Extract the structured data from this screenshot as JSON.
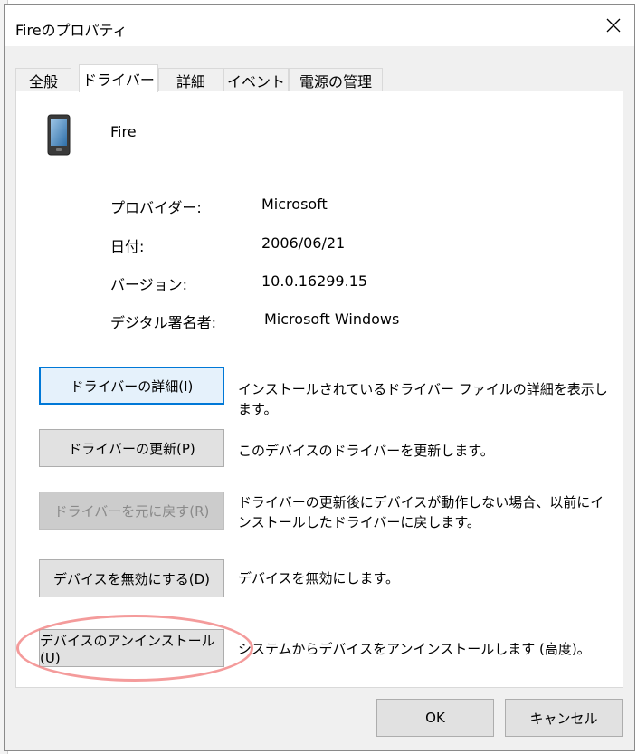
{
  "window": {
    "title": "Fireのプロパティ",
    "close_icon": "close-icon"
  },
  "tabs": [
    {
      "label": "全般",
      "active": false
    },
    {
      "label": "ドライバー",
      "active": true
    },
    {
      "label": "詳細",
      "active": false
    },
    {
      "label": "イベント",
      "active": false
    },
    {
      "label": "電源の管理",
      "active": false
    }
  ],
  "device": {
    "name": "Fire",
    "icon": "phone-icon"
  },
  "info": [
    {
      "label": "プロバイダー:",
      "value": "Microsoft"
    },
    {
      "label": "日付:",
      "value": "2006/06/21"
    },
    {
      "label": "バージョン:",
      "value": "10.0.16299.15"
    },
    {
      "label": "デジタル署名者:",
      "value": "Microsoft Windows"
    }
  ],
  "actions": [
    {
      "button": "ドライバーの詳細(I)",
      "description": "インストールされているドライバー ファイルの詳細を表示します。",
      "enabled": true,
      "focused": true
    },
    {
      "button": "ドライバーの更新(P)",
      "description": "このデバイスのドライバーを更新します。",
      "enabled": true,
      "focused": false
    },
    {
      "button": "ドライバーを元に戻す(R)",
      "description": "ドライバーの更新後にデバイスが動作しない場合、以前にインストールしたドライバーに戻します。",
      "enabled": false,
      "focused": false
    },
    {
      "button": "デバイスを無効にする(D)",
      "description": "デバイスを無効にします。",
      "enabled": true,
      "focused": false
    },
    {
      "button": "デバイスのアンインストール(U)",
      "description": "システムからデバイスをアンインストールします (高度)。",
      "enabled": true,
      "focused": false
    }
  ],
  "footer": {
    "ok": "OK",
    "cancel": "キャンセル"
  },
  "colors": {
    "accent": "#0078d7",
    "highlight_circle": "#f28a8a"
  }
}
